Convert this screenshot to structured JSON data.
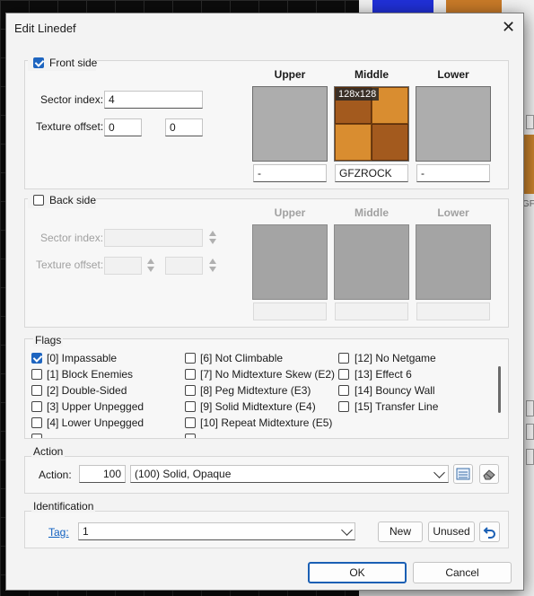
{
  "dialog": {
    "title": "Edit Linedef",
    "close_glyph": "✕"
  },
  "front": {
    "label": "Front side",
    "checked": true,
    "sector_index_label": "Sector index:",
    "sector_index": "4",
    "offset_label": "Texture offset:",
    "offset_x": "0",
    "offset_y": "0",
    "upper_label": "Upper",
    "middle_label": "Middle",
    "lower_label": "Lower",
    "upper_tex": "-",
    "middle_tex": "GFZROCK",
    "lower_tex": "-",
    "middle_size": "128x128"
  },
  "back": {
    "label": "Back side",
    "checked": false,
    "sector_index_label": "Sector index:",
    "offset_label": "Texture offset:",
    "upper_label": "Upper",
    "middle_label": "Middle",
    "lower_label": "Lower"
  },
  "flags": {
    "title": "Flags",
    "col1": [
      {
        "label": "[0] Impassable",
        "checked": true
      },
      {
        "label": "[1] Block Enemies",
        "checked": false
      },
      {
        "label": "[2] Double-Sided",
        "checked": false
      },
      {
        "label": "[3] Upper Unpegged",
        "checked": false
      },
      {
        "label": "[4] Lower Unpegged",
        "checked": false
      }
    ],
    "col2": [
      {
        "label": "[6] Not Climbable",
        "checked": false
      },
      {
        "label": "[7] No Midtexture Skew (E2)",
        "checked": false
      },
      {
        "label": "[8] Peg Midtexture (E3)",
        "checked": false
      },
      {
        "label": "[9] Solid Midtexture (E4)",
        "checked": false
      },
      {
        "label": "[10] Repeat Midtexture (E5)",
        "checked": false
      }
    ],
    "col3": [
      {
        "label": "[12] No Netgame",
        "checked": false
      },
      {
        "label": "[13] Effect 6",
        "checked": false
      },
      {
        "label": "[14] Bouncy Wall",
        "checked": false
      },
      {
        "label": "[15] Transfer Line",
        "checked": false
      }
    ]
  },
  "action": {
    "title": "Action",
    "label": "Action:",
    "number": "100",
    "selected": "(100) Solid, Opaque",
    "browse_icon": "list-browse-icon",
    "clear_icon": "eraser-icon"
  },
  "identification": {
    "title": "Identification",
    "tag_label": "Tag:",
    "tag_value": "1",
    "new_label": "New",
    "unused_label": "Unused",
    "reset_icon": "undo-icon"
  },
  "buttons": {
    "ok": "OK",
    "cancel": "Cancel"
  },
  "background": {
    "partial_texture_label": "GFZ"
  },
  "colors": {
    "accent": "#1e65c0",
    "link": "#1060c0",
    "texture_brick": "#c87a28"
  }
}
